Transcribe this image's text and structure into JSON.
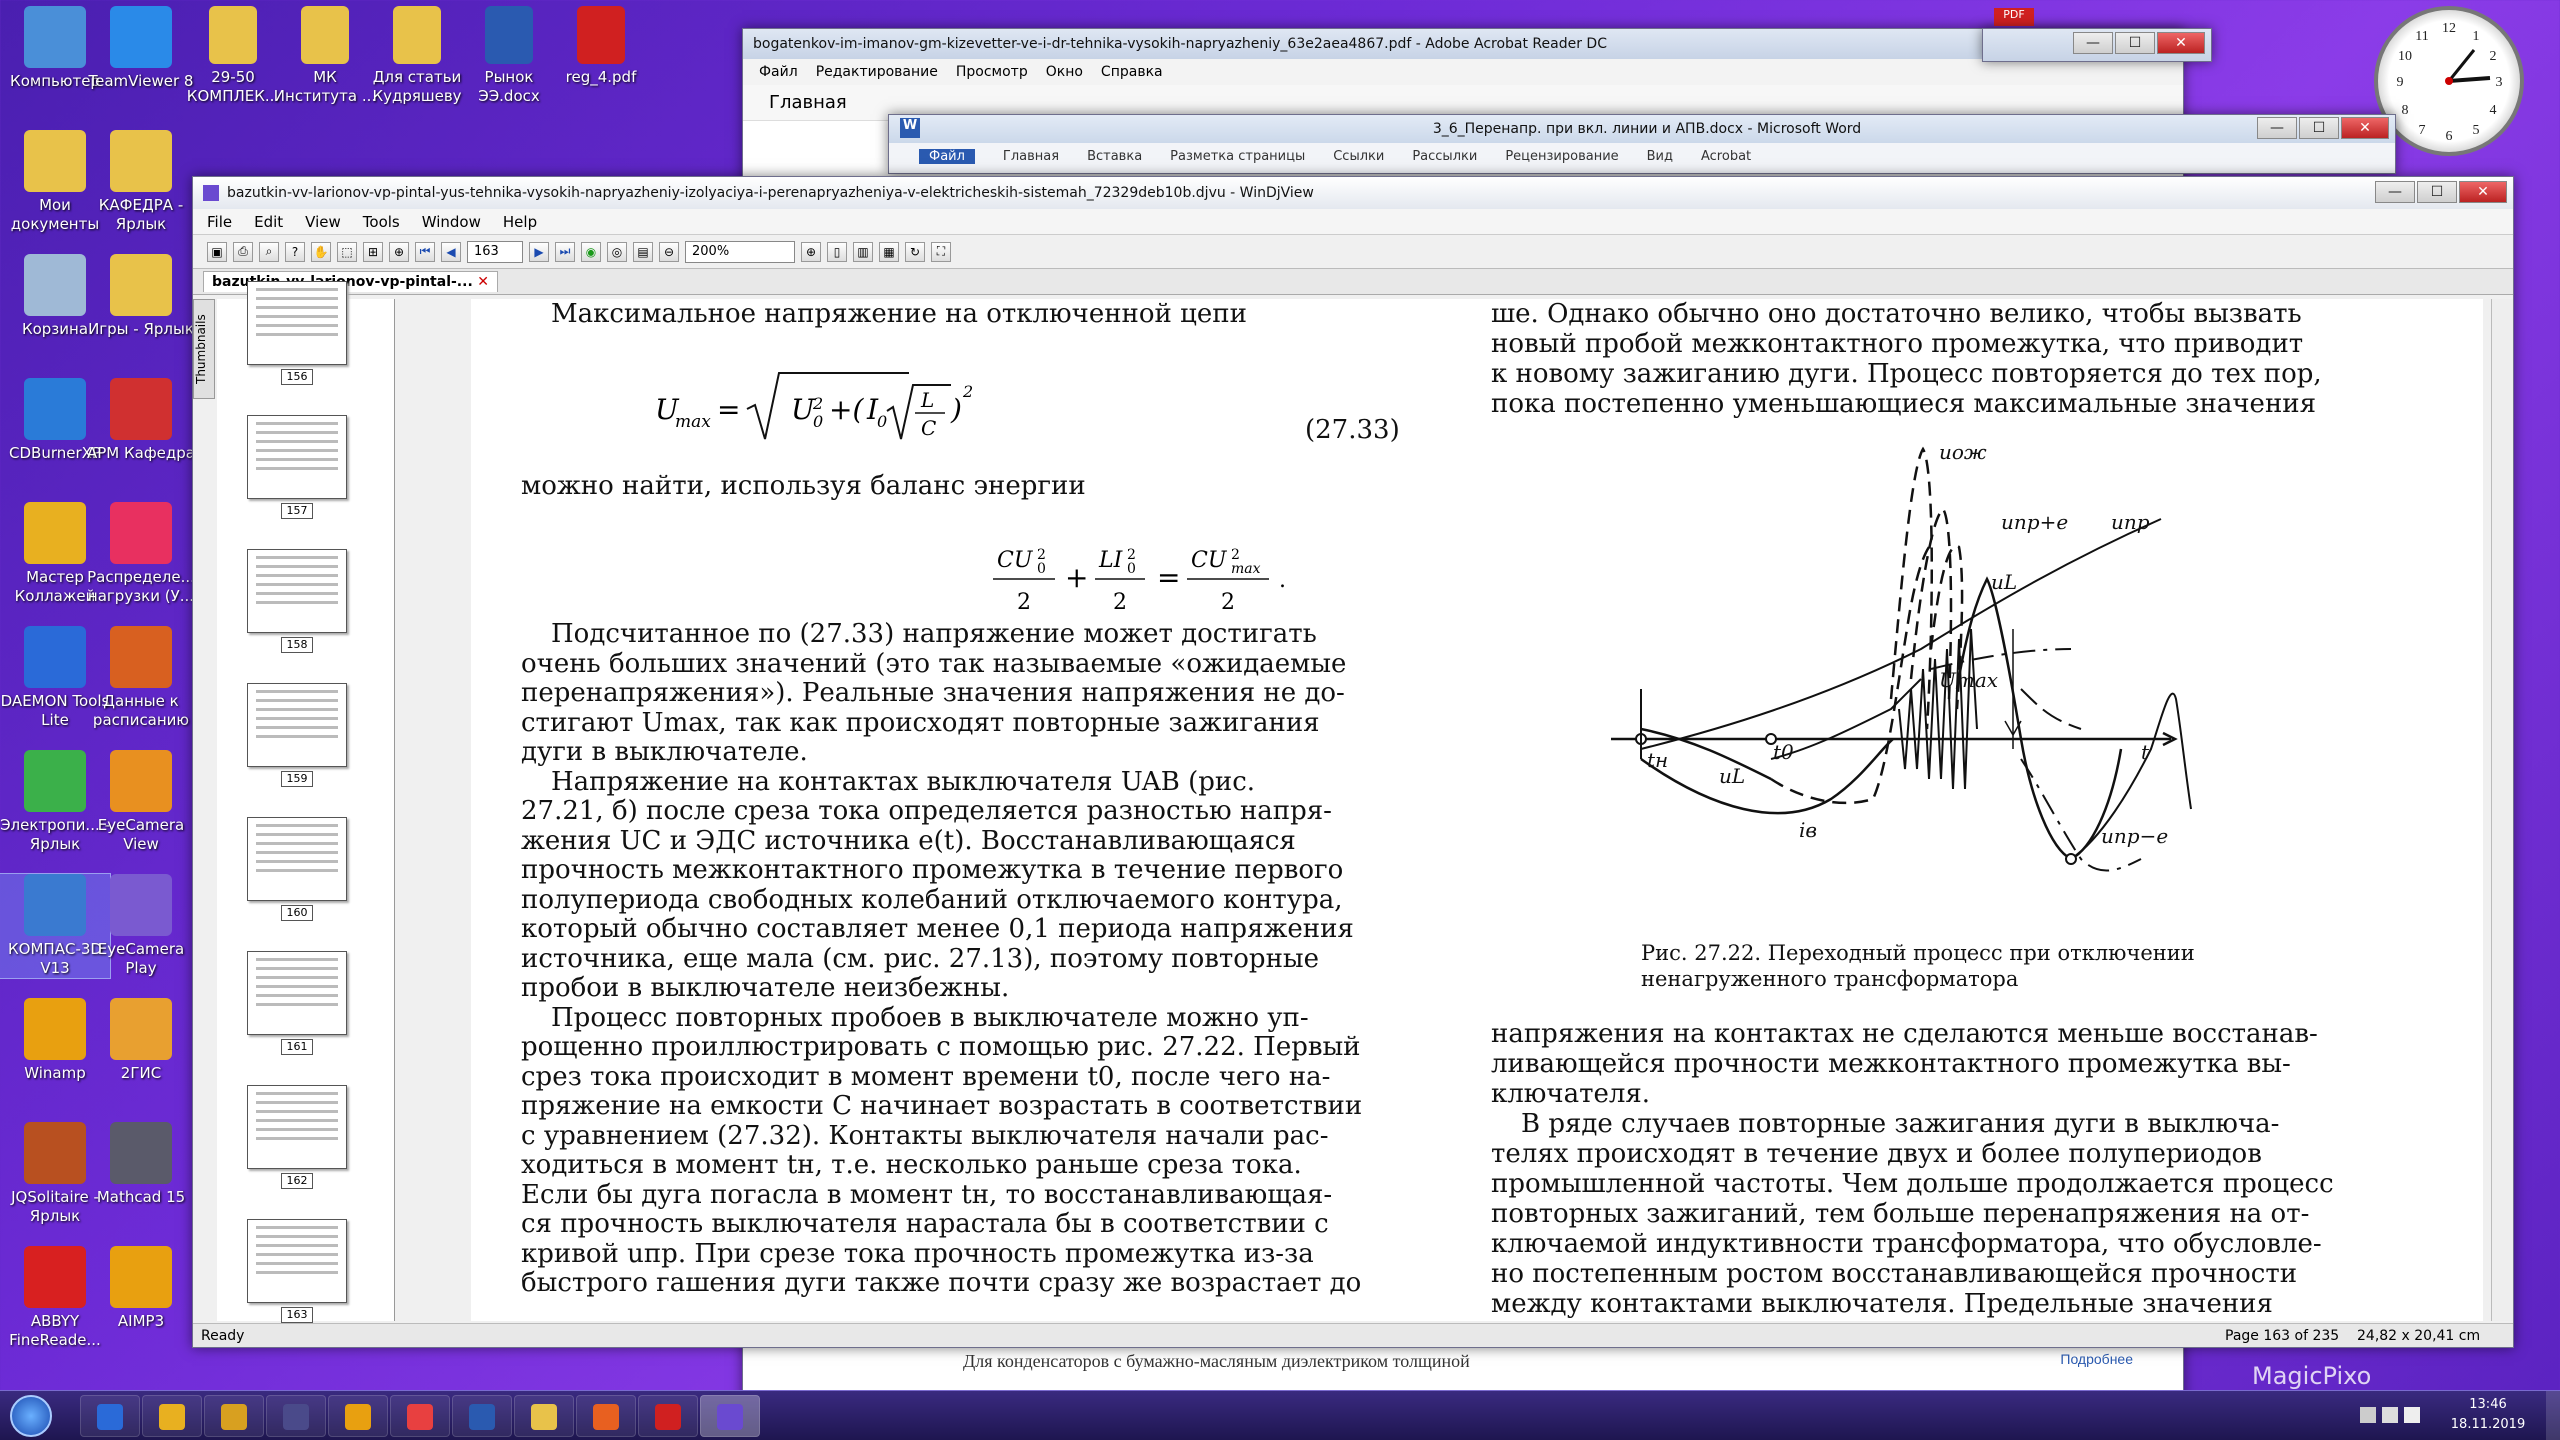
{
  "desktop": {
    "icons_left": [
      {
        "label": "Компьютер",
        "color": "#4a8fd8"
      },
      {
        "label": "Мои документы",
        "color": "#e8c24a"
      },
      {
        "label": "Корзина",
        "color": "#9fb9d6"
      },
      {
        "label": "CDBurnerXP",
        "color": "#2a7bd8"
      },
      {
        "label": "Мастер Коллажей",
        "color": "#e8b020"
      },
      {
        "label": "DAEMON Tools Lite",
        "color": "#2a6ad8"
      },
      {
        "label": "Электропи... - Ярлык",
        "color": "#3bb04a"
      },
      {
        "label": "КОМПАС-3D V13",
        "color": "#3a7ad0"
      },
      {
        "label": "Winamp",
        "color": "#e8a010"
      },
      {
        "label": "JQSolitaire - Ярлык",
        "color": "#b85020"
      },
      {
        "label": "ABBYY FineReade...",
        "color": "#d82020"
      }
    ],
    "icons_col2": [
      {
        "label": "TeamViewer 8",
        "color": "#2a8ae8"
      },
      {
        "label": "КАФЕДРА - Ярлык",
        "color": "#e8c24a"
      },
      {
        "label": "Игры - Ярлык",
        "color": "#e8c24a"
      },
      {
        "label": "АРМ Кафедра",
        "color": "#d03030"
      },
      {
        "label": "Распределе... нагрузки (У...",
        "color": "#e83060"
      },
      {
        "label": "Данные к расписанию",
        "color": "#d86020"
      },
      {
        "label": "EyeCamera View",
        "color": "#e89020"
      },
      {
        "label": "EyeCamera Play",
        "color": "#7a5ad0"
      },
      {
        "label": "2ГИС",
        "color": "#e8a030"
      },
      {
        "label": "Mathcad 15",
        "color": "#5a5a6a"
      },
      {
        "label": "AIMP3",
        "color": "#e8a010"
      }
    ],
    "icons_top": [
      {
        "label": "29-50 КОМПЛЕК...",
        "color": "#e8c24a"
      },
      {
        "label": "МК Института ...",
        "color": "#e8c24a"
      },
      {
        "label": "Для статьи Кудряшеву",
        "color": "#e8c24a"
      },
      {
        "label": "Рынок ЭЭ.docx",
        "color": "#2a5ab0"
      },
      {
        "label": "reg_4.pdf",
        "color": "#d02020"
      }
    ]
  },
  "acrobat": {
    "title": "bogatenkov-im-imanov-gm-kizevetter-ve-i-dr-tehnika-vysokih-napryazheniy_63e2aea4867.pdf - Adobe Acrobat Reader DC",
    "menu": [
      "Файл",
      "Редактирование",
      "Просмотр",
      "Окно",
      "Справка"
    ],
    "tab": "Главная",
    "bottom_text": "Для конденсаторов с бумажно-масляным диэлектриком толщиной",
    "bottom_link": "Подробнее"
  },
  "word": {
    "title": "3_6_Перенапр. при вкл. линии и АПВ.docx - Microsoft Word",
    "ribbon": [
      "Файл",
      "Главная",
      "Вставка",
      "Разметка страницы",
      "Ссылки",
      "Рассылки",
      "Рецензирование",
      "Вид",
      "Acrobat"
    ]
  },
  "djvu": {
    "title": "bazutkin-vv-larionov-vp-pintal-yus-tehnika-vysokih-napryazheniy-izolyaciya-i-perenapryazheniya-v-elektricheskih-sistemah_72329deb10b.djvu - WinDjView",
    "menu": [
      "File",
      "Edit",
      "View",
      "Tools",
      "Window",
      "Help"
    ],
    "page_field": "163",
    "zoom": "200%",
    "doc_tab": "bazutkin-vv-larionov-vp-pintal-...",
    "side_label": "Thumbnails",
    "thumbs": [
      "156",
      "157",
      "158",
      "159",
      "160",
      "161",
      "162",
      "163"
    ],
    "status_ready": "Ready",
    "status_page": "Page 163 of 235",
    "status_size": "24,82 x 20,41 cm"
  },
  "page": {
    "left_lines": [
      "Максимальное напряжение на отключенной цепи",
      "можно найти, используя баланс энергии",
      "Подсчитанное по (27.33) напряжение может достигать",
      "очень больших значений (это так называемые «ожидаемые",
      "перенапряжения»). Реальные значения напряжения не до-",
      "стигают Umax, так как происходят повторные зажигания",
      "дуги в выключателе.",
      "Напряжение на контактах выключателя UAB (рис.",
      "27.21, б) после среза тока определяется разностью напря-",
      "жения UC и ЭДС источника e(t). Восстанавливающаяся",
      "прочность межконтактного промежутка в течение первого",
      "полупериода свободных колебаний отключаемого контура,",
      "который обычно составляет менее 0,1 периода напряжения",
      "источника, еще мала (см. рис. 27.13), поэтому повторные",
      "пробои в выключателе неизбежны.",
      "Процесс повторных пробоев в выключателе можно уп-",
      "рощенно проиллюстрировать с помощью рис. 27.22. Первый",
      "срез тока происходит в момент времени t0, после чего на-",
      "пряжение на емкости C начинает возрастать в соответствии",
      "с уравнением (27.32). Контакты выключателя начали рас-",
      "ходиться в момент tн, т.е. несколько раньше среза тока.",
      "Если бы дуга погасла в момент tн, то восстанавливающая-",
      "ся прочность выключателя нарастала бы в соответствии с",
      "кривой uпр. При срезе тока прочность промежутка из-за",
      "быстрого гашения дуги также почти сразу же возрастает до"
    ],
    "eq_number": "(27.33)",
    "eq1": "Umax = √(U0² + (I0 √(L/C))²)",
    "eq2": "CU0²/2 + LI0²/2 = CUmax²/2 .",
    "right_top": [
      "ше. Однако обычно оно достаточно велико, чтобы вызвать",
      "новый пробой межконтактного промежутка, что приводит",
      "к новому зажиганию дуги. Процесс повторяется до тех пор,",
      "пока постепенно уменьшающиеся максимальные значения"
    ],
    "caption1": "Рис. 27.22. Переходный процесс при  отключении",
    "caption2": "ненагруженного трансформатора",
    "right_bottom": [
      "напряжения на контактах не сделаются меньше восстанав-",
      "ливающейся прочности межконтактного промежутка вы-",
      "ключателя.",
      "В ряде случаев повторные зажигания дуги в выключа-",
      "телях происходят в течение двух и более полупериодов",
      "промышленной частоты. Чем дольше продолжается процесс",
      "повторных зажиганий, тем больше перенапряжения на от-",
      "ключаемой индуктивности трансформатора, что обусловле-",
      "но постепенным ростом восстанавливающейся прочности",
      "между контактами выключателя. Предельные значения"
    ],
    "fig_labels": {
      "uozh": "uож",
      "upr_e": "uпр+e",
      "upr": "uпр",
      "uL": "uL",
      "umax": "Umax",
      "tn": "tн",
      "t0": "t0",
      "t": "t",
      "uL2": "uL",
      "iv": "iв",
      "upr_minus_e": "uпр−e"
    }
  },
  "taskbar": {
    "time": "13:46",
    "date": "18.11.2019",
    "watermark": "MagicPixo"
  }
}
